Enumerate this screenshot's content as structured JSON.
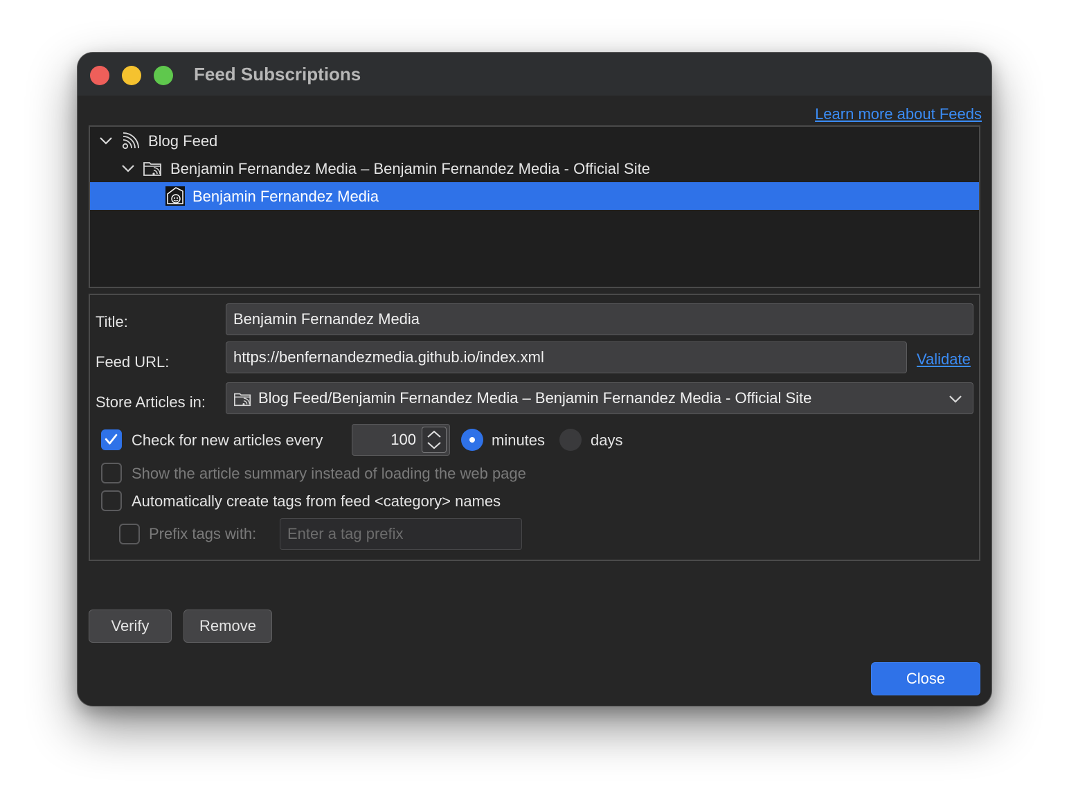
{
  "window": {
    "title": "Feed Subscriptions"
  },
  "header": {
    "learn_more_link": "Learn more about Feeds"
  },
  "tree": {
    "items": [
      {
        "label": "Blog Feed",
        "icon": "rss-feed-icon",
        "expanded": true,
        "level": 0
      },
      {
        "label": "Benjamin Fernandez Media – Benjamin Fernandez Media - Official Site",
        "icon": "feed-folder-icon",
        "expanded": true,
        "level": 1
      },
      {
        "label": "Benjamin Fernandez Media",
        "icon": "site-favicon",
        "selected": true,
        "level": 2
      }
    ]
  },
  "form": {
    "title_label": "Title:",
    "title_value": "Benjamin Fernandez Media",
    "feed_url_label": "Feed URL:",
    "feed_url_value": "https://benfernandezmedia.github.io/index.xml",
    "validate_link": "Validate",
    "store_label": "Store Articles in:",
    "store_value": "Blog Feed/Benjamin Fernandez Media – Benjamin Fernandez Media - Official Site",
    "check_label": "Check for new articles every",
    "check_checked": true,
    "interval_value": "100",
    "unit_minutes_label": "minutes",
    "unit_days_label": "days",
    "unit_selected": "minutes",
    "summary_label": "Show the article summary instead of loading the web page",
    "summary_checked": false,
    "autotag_label": "Automatically create tags from feed <category> names",
    "autotag_checked": false,
    "prefix_label": "Prefix tags with:",
    "prefix_checked": false,
    "prefix_placeholder": "Enter a tag prefix"
  },
  "buttons": {
    "verify": "Verify",
    "remove": "Remove",
    "close": "Close"
  },
  "colors": {
    "accent": "#2f72e8",
    "link": "#3b8cf5",
    "window_bg": "#262626",
    "close_light": "#ee5f5a",
    "minimize_light": "#f5c22f",
    "maximize_light": "#5fc84d"
  }
}
